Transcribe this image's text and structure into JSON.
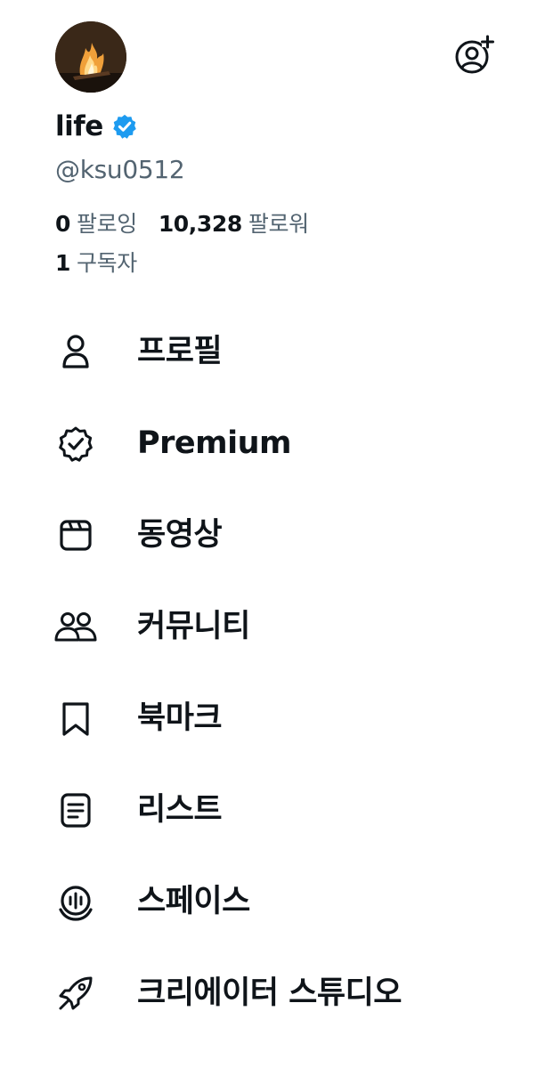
{
  "profile": {
    "display_name": "life",
    "handle": "@ksu0512",
    "following_count": "0",
    "following_label": "팔로잉",
    "followers_count": "10,328",
    "followers_label": "팔로워",
    "subscribers_count": "1",
    "subscribers_label": "구독자",
    "verified_badge_color": "#1d9bf0"
  },
  "header": {
    "add_account_icon": "person-add-icon"
  },
  "menu": {
    "items": [
      {
        "label": "프로필",
        "icon": "person-icon"
      },
      {
        "label": "Premium",
        "icon": "verified-badge-icon"
      },
      {
        "label": "동영상",
        "icon": "video-clapper-icon"
      },
      {
        "label": "커뮤니티",
        "icon": "people-icon"
      },
      {
        "label": "북마크",
        "icon": "bookmark-icon"
      },
      {
        "label": "리스트",
        "icon": "list-icon"
      },
      {
        "label": "스페이스",
        "icon": "microphone-spaces-icon"
      },
      {
        "label": "크리에이터 스튜디오",
        "icon": "rocket-icon"
      }
    ]
  },
  "colors": {
    "text_primary": "#0f1419",
    "text_secondary": "#536471",
    "accent": "#1d9bf0",
    "background": "#ffffff"
  }
}
